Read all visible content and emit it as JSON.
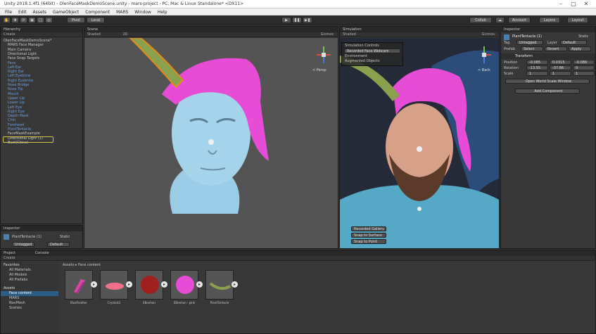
{
  "window": {
    "title": "Unity 2018.1.4f1 (64bit) - OlenFaceMaskDemoScene.unity - mars-project - PC, Mac & Linux Standalone* <DX11>"
  },
  "menu": [
    "File",
    "Edit",
    "Assets",
    "GameObject",
    "Component",
    "MARS",
    "Window",
    "Help"
  ],
  "toolbar": {
    "pivot": "Pivot",
    "local": "Local",
    "collab": "Collab",
    "account": "Account",
    "layers": "Layers",
    "layout": "Layout"
  },
  "hierarchy": {
    "title": "Hierarchy",
    "create": "Create",
    "items": [
      {
        "label": "OlenFaceMaskDemoScene*",
        "blue": false
      },
      {
        "label": "MARS Face Manager",
        "blue": false
      },
      {
        "label": "Main Camera",
        "blue": false
      },
      {
        "label": "Directional Light",
        "blue": false
      },
      {
        "label": "Face Snap Targets",
        "blue": false
      },
      {
        "label": "Face",
        "blue": true
      },
      {
        "label": "Left Ear",
        "blue": true
      },
      {
        "label": "Right Ear",
        "blue": true
      },
      {
        "label": "Left Eyebrow",
        "blue": true
      },
      {
        "label": "Right Eyebrow",
        "blue": true
      },
      {
        "label": "Nose Bridge",
        "blue": true
      },
      {
        "label": "Nose Tip",
        "blue": true
      },
      {
        "label": "Mouth",
        "blue": true
      },
      {
        "label": "Upper Lip",
        "blue": true
      },
      {
        "label": "Lower Lip",
        "blue": true
      },
      {
        "label": "Left Eye",
        "blue": true
      },
      {
        "label": "Right Eye",
        "blue": true
      },
      {
        "label": "Depth Mask",
        "blue": true
      },
      {
        "label": "Chin",
        "blue": true
      },
      {
        "label": "Forehead",
        "blue": true
      },
      {
        "label": "PlantTentacle",
        "blue": true
      },
      {
        "label": "FaceMaskExample",
        "blue": false
      },
      {
        "label": "Directional Light (1)",
        "blue": false
      },
      {
        "label": "Bust(Clone)",
        "blue": false
      }
    ]
  },
  "scene": {
    "tab": "Scene",
    "shaded": "Shaded",
    "mode": "2D",
    "gizmos": "Gizmos",
    "persp": "< Persp"
  },
  "simulation": {
    "tab": "Simulation",
    "shaded": "Shaded",
    "gizmos": "Gizmos",
    "title": "Simulation Controls",
    "environment": "Environment",
    "augmented": "Augmented Objects",
    "source": "Recorded Face Webcam",
    "buttons": [
      "Recorded Gallery",
      "Snap to Surface",
      "Snap to Point"
    ],
    "back": "< Back"
  },
  "inspector": {
    "title": "Inspector",
    "object": "PlantTentacle (1)",
    "static": "Static",
    "tag_label": "Tag",
    "tag": "Untagged",
    "layer_label": "Layer",
    "layer": "Default",
    "prefab_label": "Prefab",
    "prefab_buttons": [
      "Select",
      "Revert",
      "Apply"
    ],
    "transform": "Transform",
    "rows": [
      {
        "label": "Position",
        "x": "-0.085",
        "y": "0.0315",
        "z": "-0.089"
      },
      {
        "label": "Rotation",
        "x": "-13.55",
        "y": "-37.86",
        "z": "0"
      },
      {
        "label": "Scale",
        "x": "1",
        "y": "1",
        "z": "1"
      }
    ],
    "open_btn": "Open World Scale Window",
    "add_btn": "Add Component"
  },
  "inspector2": {
    "title": "Inspector",
    "object": "PlantTentacle (1)",
    "static": "Static",
    "tag": "Untagged",
    "layer": "Default"
  },
  "project": {
    "tab": "Project",
    "console": "Console",
    "create": "Create",
    "favorites": "Favorites",
    "fav_items": [
      "All Materials",
      "All Models",
      "All Prefabs"
    ],
    "assets_root": "Assets",
    "asset_items": [
      "Face content",
      "MARS",
      "NavMesh",
      "Scenes"
    ],
    "breadcrumb": "Assets ▸ Face content",
    "assets": [
      "BlueFeather",
      "Crystals3",
      "EBeehan",
      "EBeehan - pink",
      "PlantTentacle"
    ]
  },
  "colors": {
    "accent": "#2c5d87",
    "hair": "#e64cd6",
    "skin": "#9fd0e8"
  }
}
